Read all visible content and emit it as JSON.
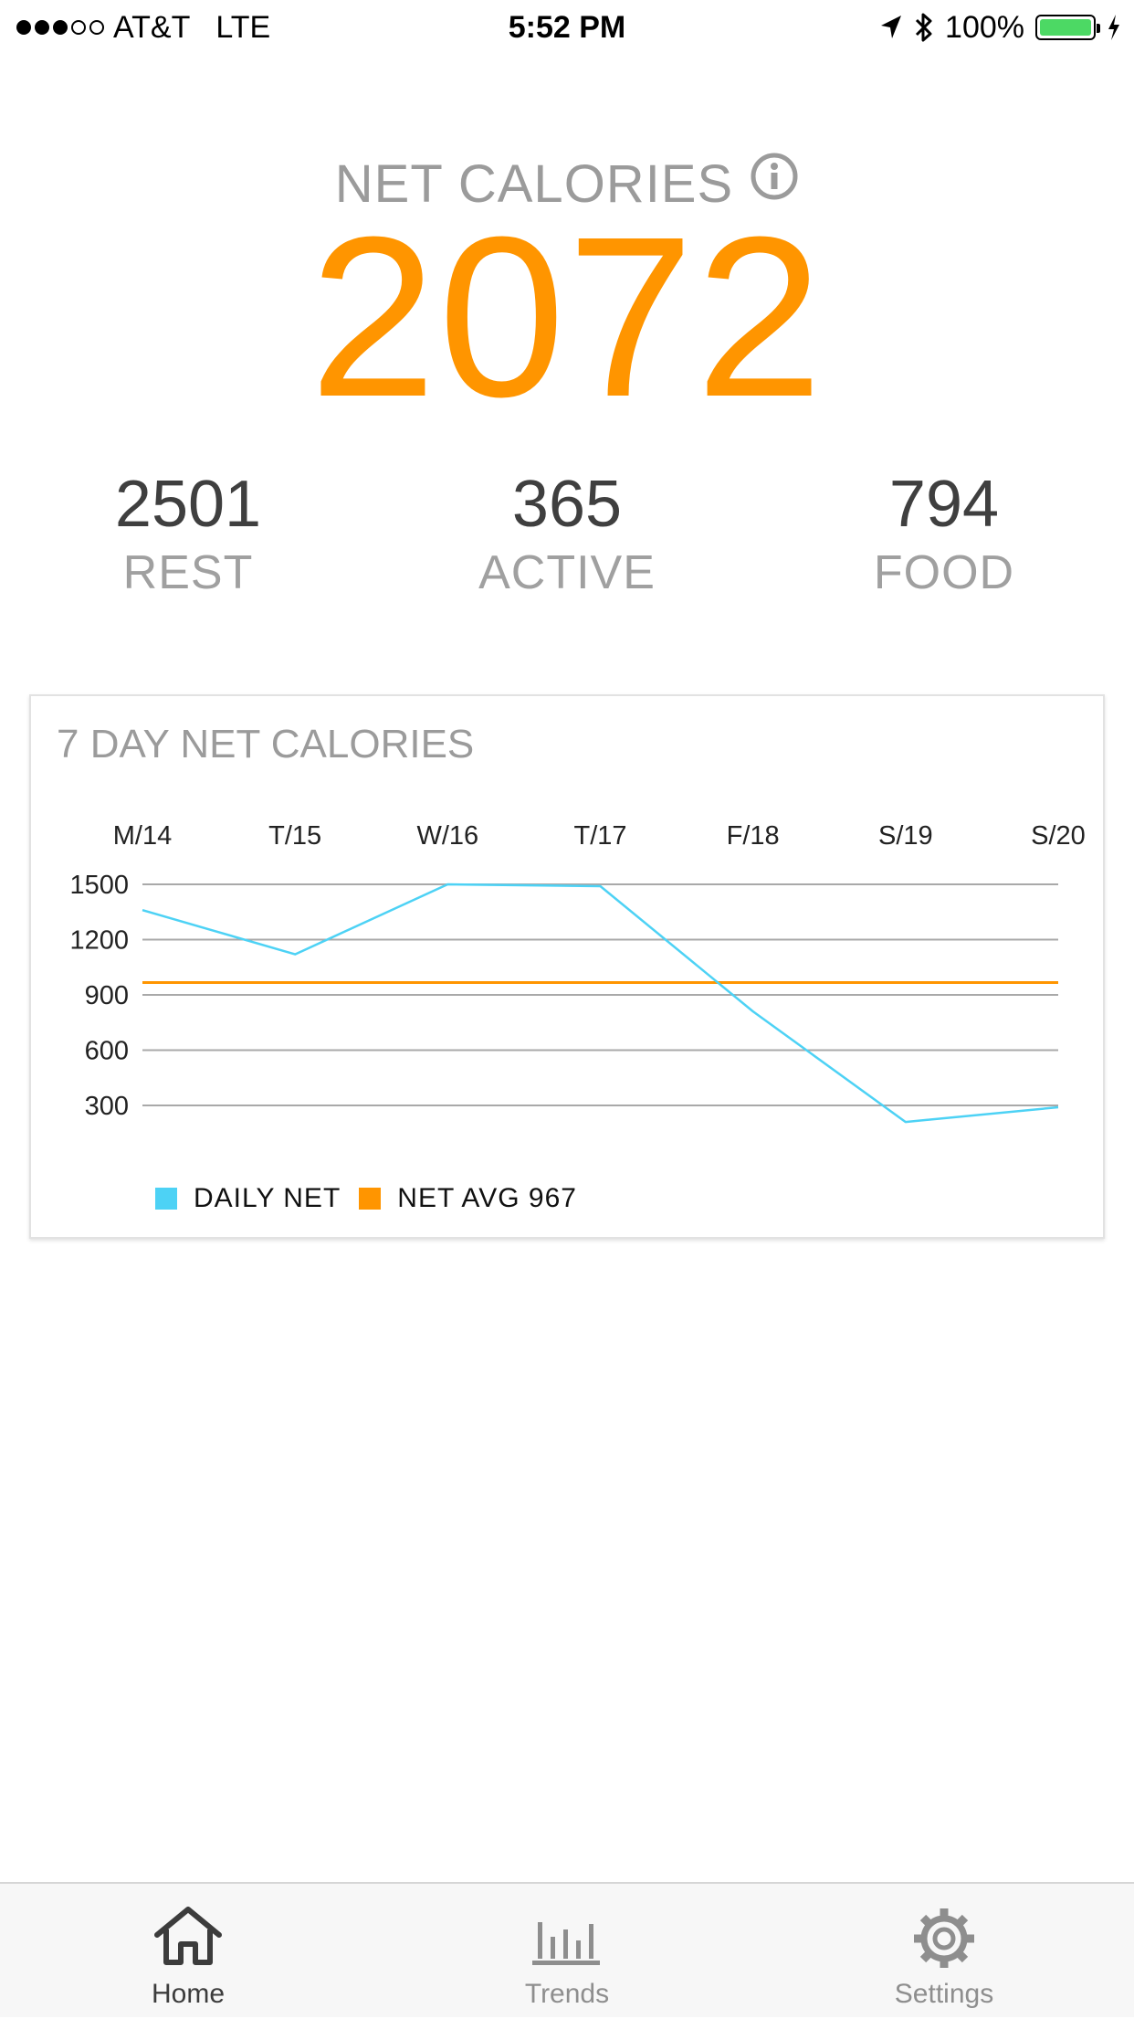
{
  "status_bar": {
    "carrier": "AT&T",
    "network": "LTE",
    "time": "5:52 PM",
    "battery": "100%",
    "battery_level": 1.0,
    "signal_strength": 3,
    "signal_max": 5
  },
  "summary": {
    "title": "NET CALORIES",
    "net_value": "2072",
    "stats": [
      {
        "value": "2501",
        "label": "REST"
      },
      {
        "value": "365",
        "label": "ACTIVE"
      },
      {
        "value": "794",
        "label": "FOOD"
      }
    ]
  },
  "chart_card": {
    "title": "7 DAY NET CALORIES"
  },
  "chart_data": {
    "type": "line",
    "title": "7 DAY NET CALORIES",
    "categories": [
      "M/14",
      "T/15",
      "W/16",
      "T/17",
      "F/18",
      "S/19",
      "S/20"
    ],
    "y_ticks": [
      "1500",
      "1200",
      "900",
      "600",
      "300"
    ],
    "ylim": [
      300,
      1500
    ],
    "grid": true,
    "x_axis_position": "top",
    "legend_position": "bottom-left",
    "series": [
      {
        "name": "DAILY NET",
        "color": "#4dd2f5",
        "values": [
          1360,
          1120,
          1500,
          1490,
          810,
          210,
          290
        ]
      },
      {
        "name": "NET AVG 967",
        "color": "#ff9500",
        "values": [
          967,
          967,
          967,
          967,
          967,
          967,
          967
        ]
      }
    ]
  },
  "tabs": [
    {
      "label": "Home",
      "icon": "home-icon",
      "active": true
    },
    {
      "label": "Trends",
      "icon": "bar-chart-icon",
      "active": false
    },
    {
      "label": "Settings",
      "icon": "gear-icon",
      "active": false
    }
  ],
  "colors": {
    "accent": "#ff9500",
    "series_line": "#4dd2f5",
    "muted_text": "#9b9b9b",
    "battery": "#4cd964"
  }
}
